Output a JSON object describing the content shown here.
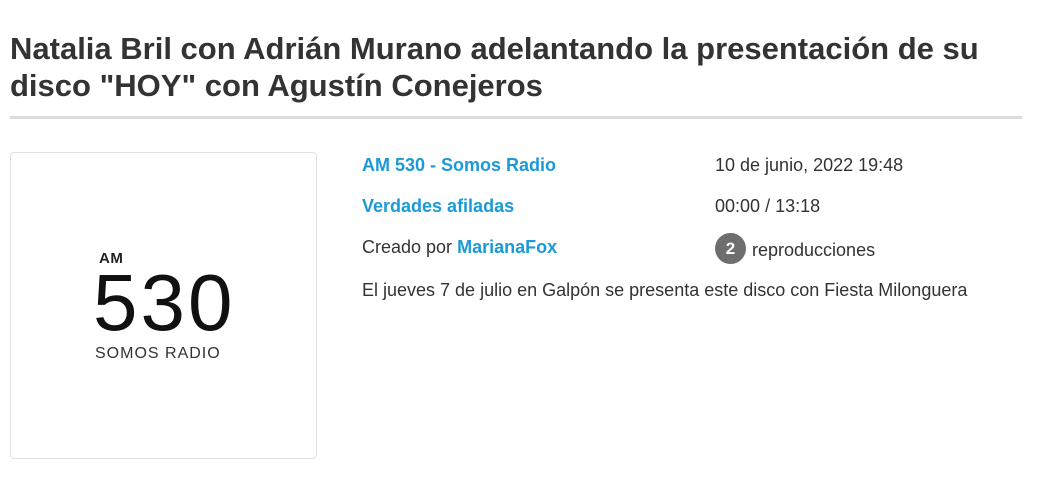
{
  "header": {
    "title": "Natalia Bril con Adrián Murano adelantando la presentación de su disco \"HOY\" con Agustín Conejeros"
  },
  "logo": {
    "am": "AM",
    "number": "530",
    "subtitle": "SOMOS RADIO"
  },
  "details": {
    "station": "AM 530 - Somos Radio",
    "program": "Verdades afiladas",
    "created_prefix": "Creado por",
    "author": "MarianaFox",
    "date": "10 de junio, 2022 19:48",
    "elapsed": "00:00",
    "separator": "/",
    "total": "13:18",
    "plays_count": "2",
    "plays_label": "reproducciones",
    "description": "El jueves 7 de julio en Galpón se presenta este disco con Fiesta Milonguera"
  },
  "colors": {
    "link": "#1a9ad6",
    "badge": "#6e6e6e",
    "text": "#333333"
  }
}
